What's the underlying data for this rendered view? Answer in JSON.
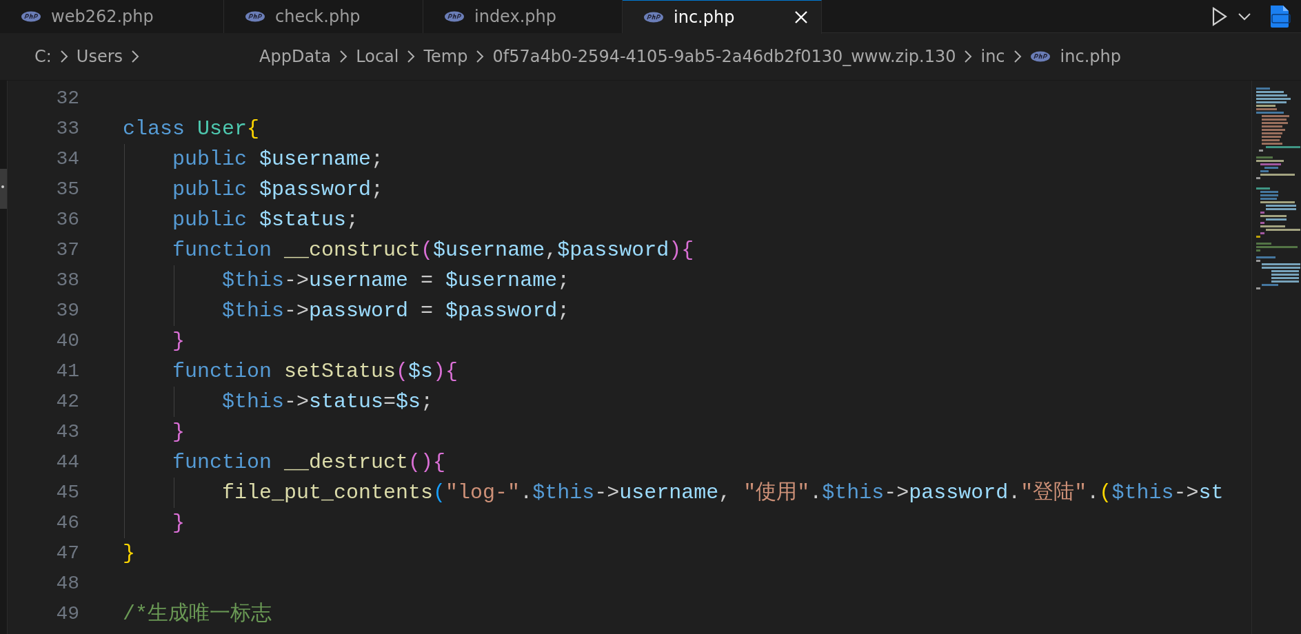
{
  "tabs": [
    {
      "label": "web262.php",
      "selected": false,
      "closable": false
    },
    {
      "label": "check.php",
      "selected": false,
      "closable": false
    },
    {
      "label": "index.php",
      "selected": false,
      "closable": false
    },
    {
      "label": "inc.php",
      "selected": true,
      "closable": true
    }
  ],
  "breadcrumbs": [
    {
      "label": "C:",
      "kind": "folder"
    },
    {
      "label": "Users",
      "kind": "folder"
    },
    {
      "label": "AppData",
      "kind": "folder"
    },
    {
      "label": "Local",
      "kind": "folder"
    },
    {
      "label": "Temp",
      "kind": "folder"
    },
    {
      "label": "0f57a4b0-2594-4105-9ab5-2a46db2f0130_www.zip.130",
      "kind": "folder"
    },
    {
      "label": "inc",
      "kind": "folder"
    },
    {
      "label": "inc.php",
      "kind": "file"
    }
  ],
  "code_lines": [
    {
      "number": "32"
    },
    {
      "number": "33",
      "tokens": [
        {
          "kind": "kw",
          "text": "class "
        },
        {
          "kind": "cls",
          "text": "User"
        },
        {
          "kind": "b1",
          "text": "{"
        }
      ]
    },
    {
      "number": "34",
      "tokens": [
        {
          "kind": "kw",
          "text": "    public "
        },
        {
          "kind": "var",
          "text": "$username"
        },
        {
          "kind": "p",
          "text": ";"
        }
      ]
    },
    {
      "number": "35",
      "tokens": [
        {
          "kind": "kw",
          "text": "    public "
        },
        {
          "kind": "var",
          "text": "$password"
        },
        {
          "kind": "p",
          "text": ";"
        }
      ]
    },
    {
      "number": "36",
      "tokens": [
        {
          "kind": "kw",
          "text": "    public "
        },
        {
          "kind": "var",
          "text": "$status"
        },
        {
          "kind": "p",
          "text": ";"
        }
      ]
    },
    {
      "number": "37",
      "tokens": [
        {
          "kind": "kw",
          "text": "    function "
        },
        {
          "kind": "fn",
          "text": "__construct"
        },
        {
          "kind": "b2",
          "text": "("
        },
        {
          "kind": "var",
          "text": "$username"
        },
        {
          "kind": "p",
          "text": ","
        },
        {
          "kind": "var",
          "text": "$password"
        },
        {
          "kind": "b2",
          "text": "){"
        }
      ]
    },
    {
      "number": "38",
      "tokens": [
        {
          "kind": "kw",
          "text": "        $this"
        },
        {
          "kind": "p",
          "text": "->"
        },
        {
          "kind": "var",
          "text": "username"
        },
        {
          "kind": "p",
          "text": " = "
        },
        {
          "kind": "var",
          "text": "$username"
        },
        {
          "kind": "p",
          "text": ";"
        }
      ]
    },
    {
      "number": "39",
      "tokens": [
        {
          "kind": "kw",
          "text": "        $this"
        },
        {
          "kind": "p",
          "text": "->"
        },
        {
          "kind": "var",
          "text": "password"
        },
        {
          "kind": "p",
          "text": " = "
        },
        {
          "kind": "var",
          "text": "$password"
        },
        {
          "kind": "p",
          "text": ";"
        }
      ]
    },
    {
      "number": "40",
      "tokens": [
        {
          "kind": "b2",
          "text": "    }"
        }
      ]
    },
    {
      "number": "41",
      "tokens": [
        {
          "kind": "kw",
          "text": "    function "
        },
        {
          "kind": "fn",
          "text": "setStatus"
        },
        {
          "kind": "b2",
          "text": "("
        },
        {
          "kind": "var",
          "text": "$s"
        },
        {
          "kind": "b2",
          "text": "){"
        }
      ]
    },
    {
      "number": "42",
      "tokens": [
        {
          "kind": "kw",
          "text": "        $this"
        },
        {
          "kind": "p",
          "text": "->"
        },
        {
          "kind": "var",
          "text": "status"
        },
        {
          "kind": "p",
          "text": "="
        },
        {
          "kind": "var",
          "text": "$s"
        },
        {
          "kind": "p",
          "text": ";"
        }
      ]
    },
    {
      "number": "43",
      "tokens": [
        {
          "kind": "b2",
          "text": "    }"
        }
      ]
    },
    {
      "number": "44",
      "tokens": [
        {
          "kind": "kw",
          "text": "    function "
        },
        {
          "kind": "fn",
          "text": "__destruct"
        },
        {
          "kind": "b2",
          "text": "(){"
        }
      ]
    },
    {
      "number": "45",
      "tokens": [
        {
          "kind": "fn",
          "text": "        file_put_contents"
        },
        {
          "kind": "b3",
          "text": "("
        },
        {
          "kind": "str",
          "text": "\"log-\""
        },
        {
          "kind": "p",
          "text": "."
        },
        {
          "kind": "kw",
          "text": "$this"
        },
        {
          "kind": "p",
          "text": "->"
        },
        {
          "kind": "var",
          "text": "username"
        },
        {
          "kind": "p",
          "text": ", "
        },
        {
          "kind": "str",
          "text": "\"使用\""
        },
        {
          "kind": "p",
          "text": "."
        },
        {
          "kind": "kw",
          "text": "$this"
        },
        {
          "kind": "p",
          "text": "->"
        },
        {
          "kind": "var",
          "text": "password"
        },
        {
          "kind": "p",
          "text": "."
        },
        {
          "kind": "str",
          "text": "\"登陆\""
        },
        {
          "kind": "p",
          "text": "."
        },
        {
          "kind": "b1",
          "text": "("
        },
        {
          "kind": "kw",
          "text": "$this"
        },
        {
          "kind": "p",
          "text": "->"
        },
        {
          "kind": "var",
          "text": "st"
        }
      ]
    },
    {
      "number": "46",
      "tokens": [
        {
          "kind": "b2",
          "text": "    }"
        }
      ]
    },
    {
      "number": "47",
      "tokens": [
        {
          "kind": "b1",
          "text": "}"
        }
      ]
    },
    {
      "number": "48"
    },
    {
      "number": "49",
      "tokens": [
        {
          "kind": "cm",
          "text": "/*生成唯一标志"
        }
      ]
    }
  ]
}
